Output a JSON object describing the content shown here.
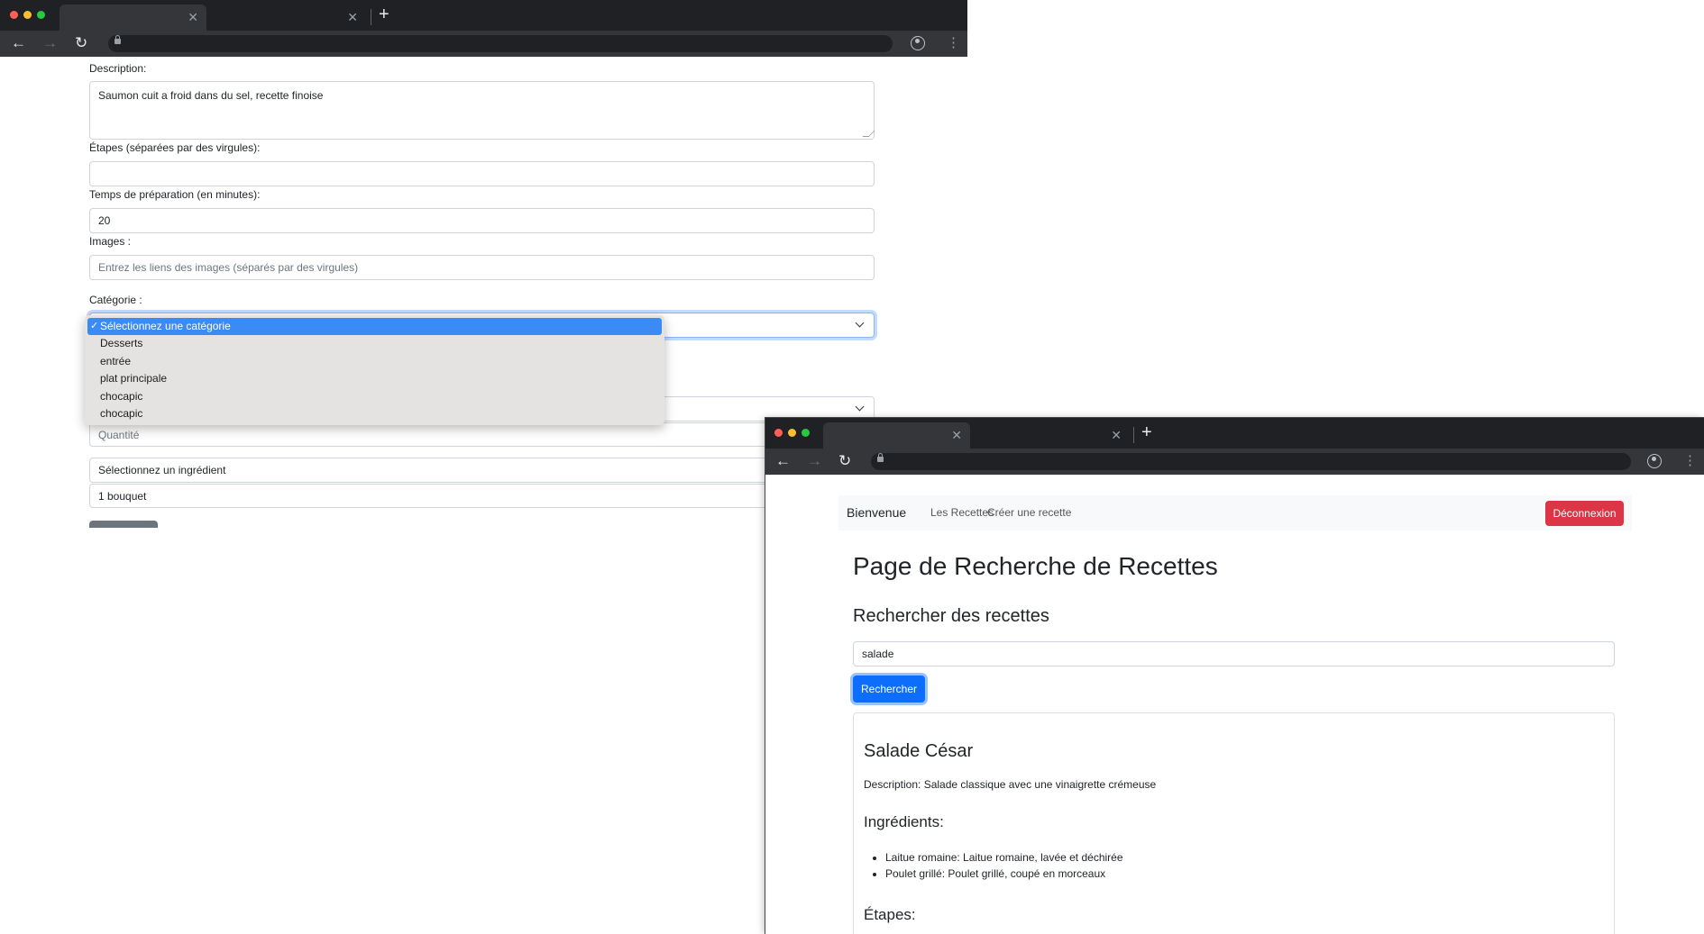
{
  "windows": {
    "back": {
      "form": {
        "description_label": "Description:",
        "description_value": "Saumon cuit a froid dans du sel, recette finoise",
        "steps_label": "Étapes (séparées par des virgules):",
        "steps_value": "",
        "prep_label": "Temps de préparation (en minutes):",
        "prep_value": "20",
        "images_label": "Images :",
        "images_placeholder": "Entrez les liens des images (séparés par des virgules)",
        "category_label": "Catégorie :",
        "category_options": [
          "Sélectionnez une catégorie",
          "Desserts",
          "entrée",
          "plat principale",
          "chocapic",
          "chocapic"
        ],
        "category_selected_index": 0,
        "quantity_placeholder": "Quantité",
        "ingredient_select_value": "Sélectionnez un ingrédient",
        "quantity_value": "1 bouquet"
      }
    },
    "front": {
      "navbar": {
        "brand": "Bienvenue",
        "links": [
          "Les Recettes",
          "Créer une recette"
        ],
        "logout": "Déconnexion"
      },
      "page_title": "Page de Recherche de Recettes",
      "search_heading": "Rechercher des recettes",
      "search_value": "salade",
      "search_button": "Rechercher",
      "result": {
        "title": "Salade César",
        "description": "Description: Salade classique avec une vinaigrette crémeuse",
        "ingredients_heading": "Ingrédients:",
        "ingredients": [
          "Laitue romaine: Laitue romaine, lavée et déchirée",
          "Poulet grillé: Poulet grillé, coupé en morceaux"
        ],
        "steps_heading": "Étapes:"
      }
    }
  },
  "colors": {
    "primary": "#0d6efd",
    "danger": "#dc3545",
    "dropdown_highlight": "#3b8bf5",
    "chrome_tabbar": "#202124",
    "chrome_toolbar": "#35363a"
  },
  "icons": [
    "close-icon",
    "plus-icon",
    "back-arrow-icon",
    "forward-arrow-icon",
    "reload-icon",
    "lock-icon",
    "profile-icon",
    "kebab-menu-icon",
    "chevron-down-icon",
    "checkmark-icon"
  ]
}
